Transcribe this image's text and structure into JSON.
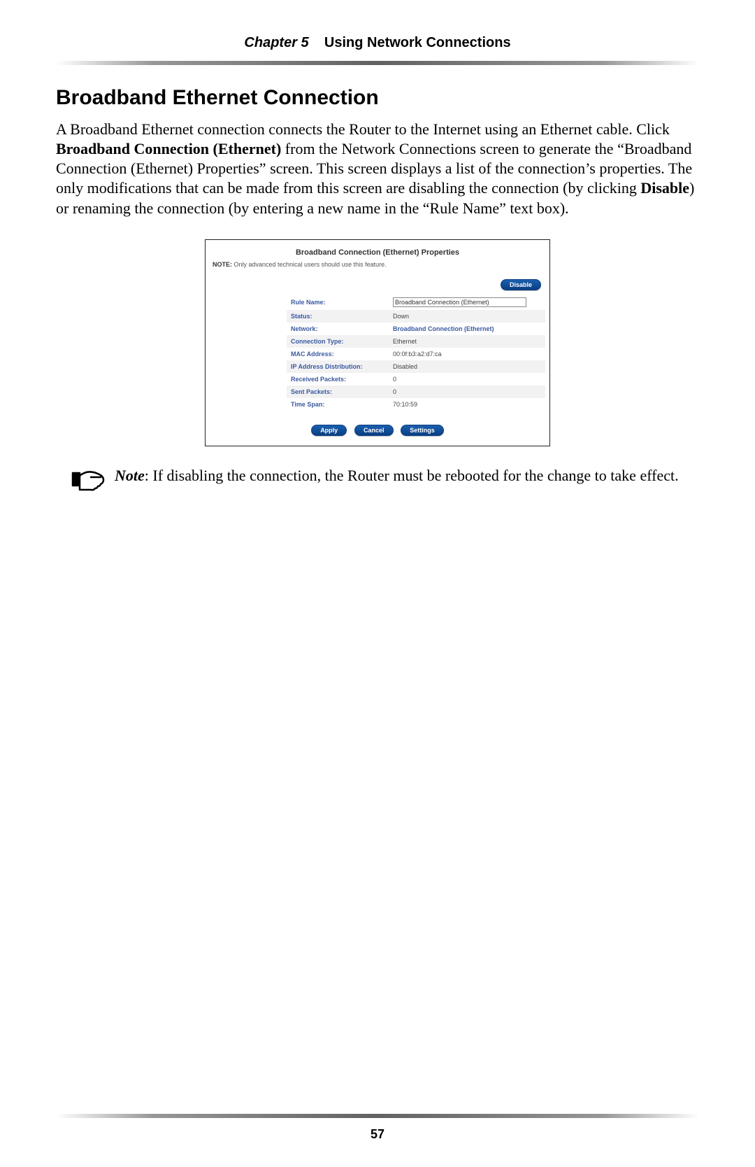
{
  "header": {
    "chapter_label": "Chapter 5",
    "chapter_title": "Using Network Connections"
  },
  "section": {
    "title": "Broadband Ethernet Connection",
    "para_a": "A Broadband Ethernet connection connects the Router to the Internet using an Ethernet cable. Click ",
    "para_bold1": "Broadband Connection (Ethernet)",
    "para_b": " from the Network Connections screen to generate the “Broadband Connection (Ethernet) Properties” screen. This screen displays a list of the connection’s properties. The only modifications that can be made from this screen are disabling the connection (by clicking ",
    "para_bold2": "Disable",
    "para_c": ") or renaming the connection (by entering a new name in the “Rule Name” text box)."
  },
  "panel": {
    "title": "Broadband Connection (Ethernet) Properties",
    "note_prefix": "NOTE:",
    "note_text": " Only advanced technical users should use this feature.",
    "disable_label": "Disable",
    "rows": {
      "rule_name_label": "Rule Name:",
      "rule_name_value": "Broadband Connection (Ethernet)",
      "status_label": "Status:",
      "status_value": "Down",
      "network_label": "Network:",
      "network_value": "Broadband Connection (Ethernet)",
      "conn_type_label": "Connection Type:",
      "conn_type_value": "Ethernet",
      "mac_label": "MAC Address:",
      "mac_value": "00:0f:b3:a2:d7:ca",
      "ipdist_label": "IP Address Distribution:",
      "ipdist_value": "Disabled",
      "recv_label": "Received Packets:",
      "recv_value": "0",
      "sent_label": "Sent Packets:",
      "sent_value": "0",
      "tspan_label": "Time Span:",
      "tspan_value": "70:10:59"
    },
    "actions": {
      "apply": "Apply",
      "cancel": "Cancel",
      "settings": "Settings"
    }
  },
  "note": {
    "label": "Note",
    "text": ": If disabling the connection, the Router must be rebooted for the change to take effect."
  },
  "page_number": "57"
}
